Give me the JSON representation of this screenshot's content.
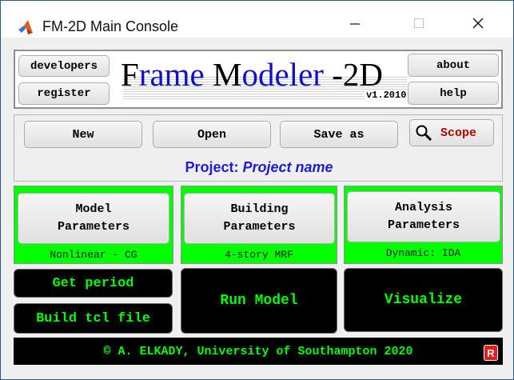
{
  "window": {
    "title": "FM-2D Main Console",
    "icon": "matlab-icon",
    "controls": {
      "minimize": "minimize-icon",
      "maximize": "maximize-icon",
      "close": "close-icon"
    }
  },
  "header": {
    "developers_label": "developers",
    "register_label": "register",
    "about_label": "about",
    "help_label": "help",
    "title_part1": "F",
    "title_part2": "rame ",
    "title_part3": "M",
    "title_part4": "odeler",
    "title_part5": " -2D",
    "version": "v1.2010"
  },
  "actions": {
    "new_label": "New",
    "open_label": "Open",
    "save_as_label": "Save as",
    "scope_label": "Scope",
    "project_prefix": "Project:",
    "project_name": "Project name"
  },
  "params": {
    "model": {
      "label_line1": "Model",
      "label_line2": "Parameters",
      "status": "Nonlinear - CG"
    },
    "building": {
      "label_line1": "Building",
      "label_line2": "Parameters",
      "status": "4-story MRF"
    },
    "analysis": {
      "label_line1": "Analysis",
      "label_line2": "Parameters",
      "status": "Dynamic: IDA"
    }
  },
  "run": {
    "get_period_label": "Get period",
    "build_tcl_label": "Build tcl file",
    "run_model_label": "Run Model",
    "visualize_label": "Visualize"
  },
  "footer": {
    "credit": "© A. ELKADY, University of Southampton 2020",
    "badge": "R"
  },
  "colors": {
    "green": "#00ff00",
    "black": "#000000",
    "title_blue": "#1010cc",
    "project_blue": "#1c1cd6",
    "scope_red": "#b00000"
  }
}
